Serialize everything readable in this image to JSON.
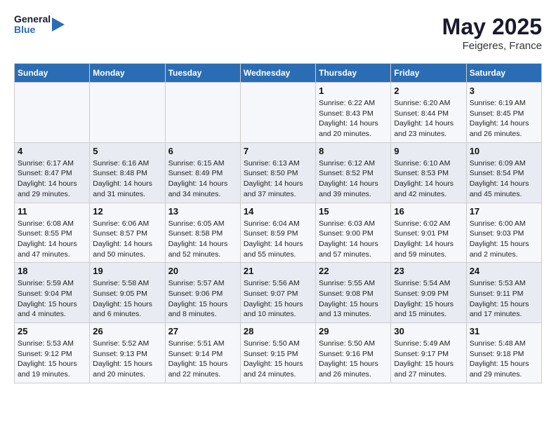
{
  "header": {
    "logo_line1": "General",
    "logo_line2": "Blue",
    "month": "May 2025",
    "location": "Feigeres, France"
  },
  "weekdays": [
    "Sunday",
    "Monday",
    "Tuesday",
    "Wednesday",
    "Thursday",
    "Friday",
    "Saturday"
  ],
  "weeks": [
    [
      {
        "day": "",
        "info": ""
      },
      {
        "day": "",
        "info": ""
      },
      {
        "day": "",
        "info": ""
      },
      {
        "day": "",
        "info": ""
      },
      {
        "day": "1",
        "info": "Sunrise: 6:22 AM\nSunset: 8:43 PM\nDaylight: 14 hours\nand 20 minutes."
      },
      {
        "day": "2",
        "info": "Sunrise: 6:20 AM\nSunset: 8:44 PM\nDaylight: 14 hours\nand 23 minutes."
      },
      {
        "day": "3",
        "info": "Sunrise: 6:19 AM\nSunset: 8:45 PM\nDaylight: 14 hours\nand 26 minutes."
      }
    ],
    [
      {
        "day": "4",
        "info": "Sunrise: 6:17 AM\nSunset: 8:47 PM\nDaylight: 14 hours\nand 29 minutes."
      },
      {
        "day": "5",
        "info": "Sunrise: 6:16 AM\nSunset: 8:48 PM\nDaylight: 14 hours\nand 31 minutes."
      },
      {
        "day": "6",
        "info": "Sunrise: 6:15 AM\nSunset: 8:49 PM\nDaylight: 14 hours\nand 34 minutes."
      },
      {
        "day": "7",
        "info": "Sunrise: 6:13 AM\nSunset: 8:50 PM\nDaylight: 14 hours\nand 37 minutes."
      },
      {
        "day": "8",
        "info": "Sunrise: 6:12 AM\nSunset: 8:52 PM\nDaylight: 14 hours\nand 39 minutes."
      },
      {
        "day": "9",
        "info": "Sunrise: 6:10 AM\nSunset: 8:53 PM\nDaylight: 14 hours\nand 42 minutes."
      },
      {
        "day": "10",
        "info": "Sunrise: 6:09 AM\nSunset: 8:54 PM\nDaylight: 14 hours\nand 45 minutes."
      }
    ],
    [
      {
        "day": "11",
        "info": "Sunrise: 6:08 AM\nSunset: 8:55 PM\nDaylight: 14 hours\nand 47 minutes."
      },
      {
        "day": "12",
        "info": "Sunrise: 6:06 AM\nSunset: 8:57 PM\nDaylight: 14 hours\nand 50 minutes."
      },
      {
        "day": "13",
        "info": "Sunrise: 6:05 AM\nSunset: 8:58 PM\nDaylight: 14 hours\nand 52 minutes."
      },
      {
        "day": "14",
        "info": "Sunrise: 6:04 AM\nSunset: 8:59 PM\nDaylight: 14 hours\nand 55 minutes."
      },
      {
        "day": "15",
        "info": "Sunrise: 6:03 AM\nSunset: 9:00 PM\nDaylight: 14 hours\nand 57 minutes."
      },
      {
        "day": "16",
        "info": "Sunrise: 6:02 AM\nSunset: 9:01 PM\nDaylight: 14 hours\nand 59 minutes."
      },
      {
        "day": "17",
        "info": "Sunrise: 6:00 AM\nSunset: 9:03 PM\nDaylight: 15 hours\nand 2 minutes."
      }
    ],
    [
      {
        "day": "18",
        "info": "Sunrise: 5:59 AM\nSunset: 9:04 PM\nDaylight: 15 hours\nand 4 minutes."
      },
      {
        "day": "19",
        "info": "Sunrise: 5:58 AM\nSunset: 9:05 PM\nDaylight: 15 hours\nand 6 minutes."
      },
      {
        "day": "20",
        "info": "Sunrise: 5:57 AM\nSunset: 9:06 PM\nDaylight: 15 hours\nand 8 minutes."
      },
      {
        "day": "21",
        "info": "Sunrise: 5:56 AM\nSunset: 9:07 PM\nDaylight: 15 hours\nand 10 minutes."
      },
      {
        "day": "22",
        "info": "Sunrise: 5:55 AM\nSunset: 9:08 PM\nDaylight: 15 hours\nand 13 minutes."
      },
      {
        "day": "23",
        "info": "Sunrise: 5:54 AM\nSunset: 9:09 PM\nDaylight: 15 hours\nand 15 minutes."
      },
      {
        "day": "24",
        "info": "Sunrise: 5:53 AM\nSunset: 9:11 PM\nDaylight: 15 hours\nand 17 minutes."
      }
    ],
    [
      {
        "day": "25",
        "info": "Sunrise: 5:53 AM\nSunset: 9:12 PM\nDaylight: 15 hours\nand 19 minutes."
      },
      {
        "day": "26",
        "info": "Sunrise: 5:52 AM\nSunset: 9:13 PM\nDaylight: 15 hours\nand 20 minutes."
      },
      {
        "day": "27",
        "info": "Sunrise: 5:51 AM\nSunset: 9:14 PM\nDaylight: 15 hours\nand 22 minutes."
      },
      {
        "day": "28",
        "info": "Sunrise: 5:50 AM\nSunset: 9:15 PM\nDaylight: 15 hours\nand 24 minutes."
      },
      {
        "day": "29",
        "info": "Sunrise: 5:50 AM\nSunset: 9:16 PM\nDaylight: 15 hours\nand 26 minutes."
      },
      {
        "day": "30",
        "info": "Sunrise: 5:49 AM\nSunset: 9:17 PM\nDaylight: 15 hours\nand 27 minutes."
      },
      {
        "day": "31",
        "info": "Sunrise: 5:48 AM\nSunset: 9:18 PM\nDaylight: 15 hours\nand 29 minutes."
      }
    ]
  ]
}
